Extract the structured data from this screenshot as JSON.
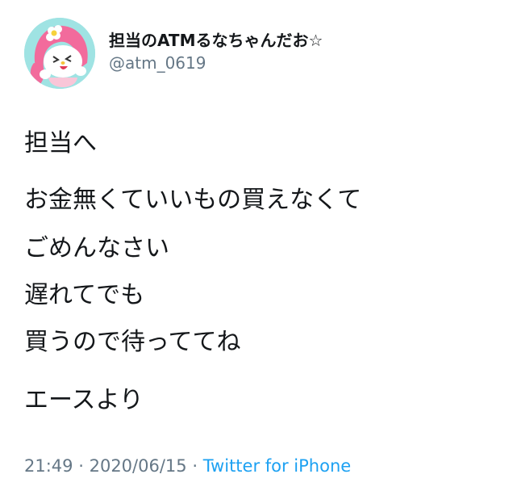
{
  "user": {
    "display_name": "担当のATMるなちゃんだお☆",
    "handle": "@atm_0619"
  },
  "tweet": {
    "lines": [
      "担当へ",
      "お金無くていいもの買えなくて",
      "ごめんなさい",
      "遅れてでも",
      "買うので待っててね",
      "エースより"
    ]
  },
  "meta": {
    "time": "21:49",
    "separator": "·",
    "date": "2020/06/15",
    "source": "Twitter for iPhone"
  }
}
